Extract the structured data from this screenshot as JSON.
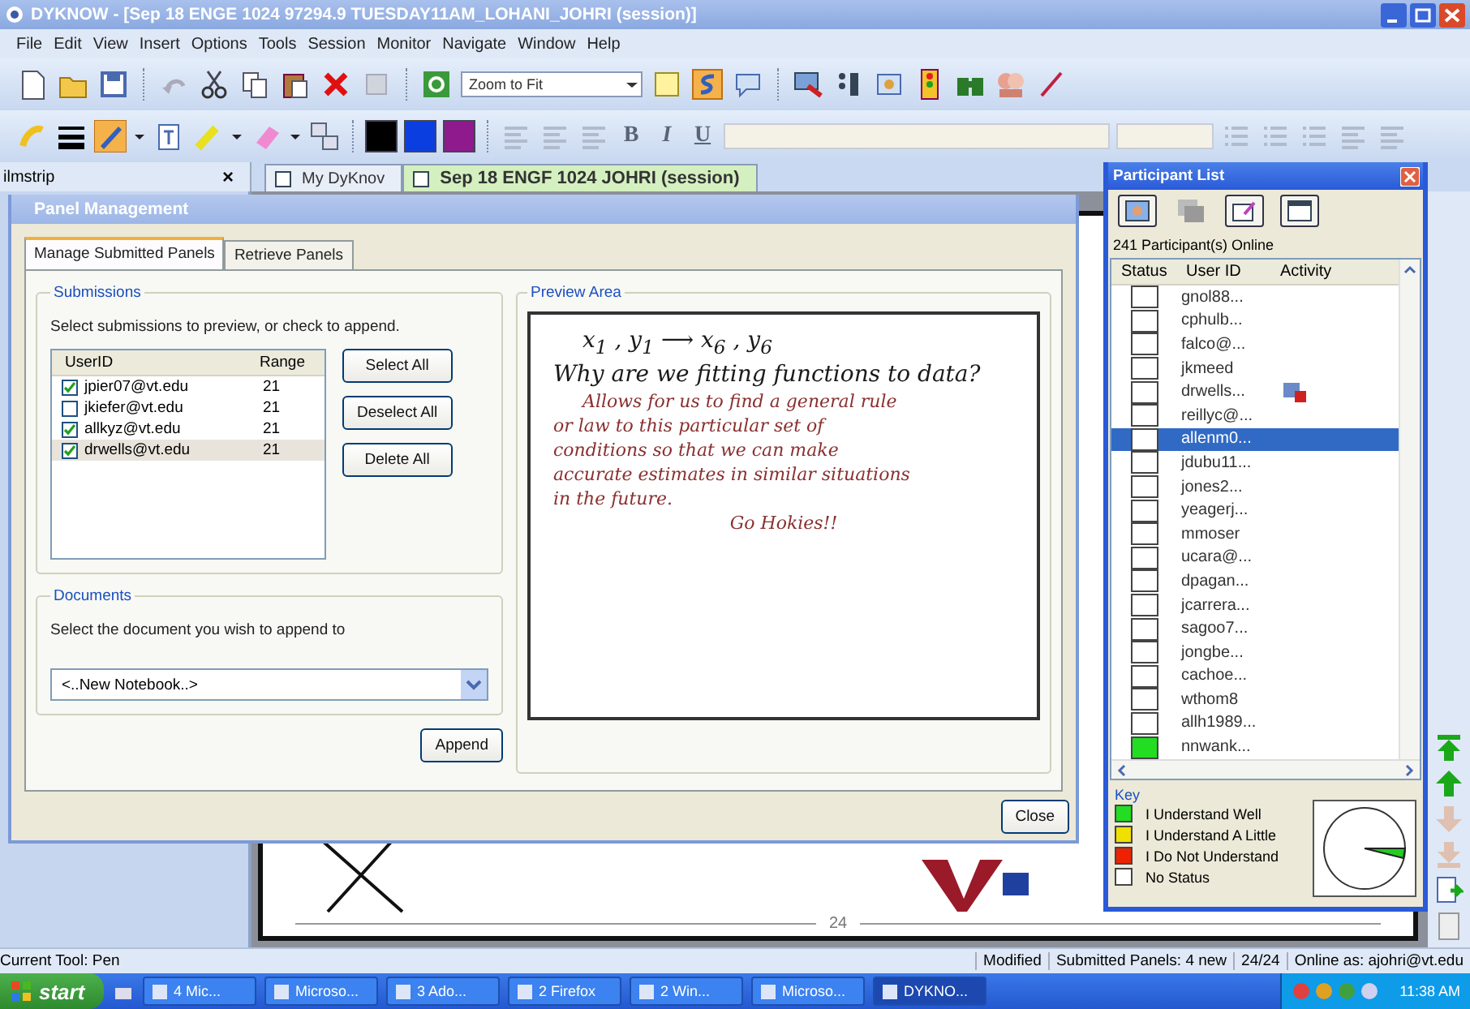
{
  "window": {
    "title": "DYKNOW - [Sep 18 ENGE 1024 97294.9 TUESDAY11AM_LOHANI_JOHRI  (session)]"
  },
  "menu": [
    "File",
    "Edit",
    "View",
    "Insert",
    "Options",
    "Tools",
    "Session",
    "Monitor",
    "Navigate",
    "Window",
    "Help"
  ],
  "toolbar": {
    "zoom": "Zoom to Fit",
    "format_buttons": [
      "B",
      "I",
      "U"
    ],
    "palette": [
      {
        "color": "#000000"
      },
      {
        "color": "#0a3ee0"
      },
      {
        "color": "#8e1a8e"
      }
    ]
  },
  "filmstrip": {
    "title": "ilmstrip",
    "close": "×"
  },
  "doc_tabs": [
    {
      "label": "My DyKnov",
      "selected": false
    },
    {
      "label": "Sep 18 ENGF 1024  JOHRI  (session)",
      "selected": true
    }
  ],
  "dialog": {
    "title": "Panel Management",
    "tabs": [
      {
        "label": "Manage Submitted Panels",
        "selected": true
      },
      {
        "label": "Retrieve Panels",
        "selected": false
      }
    ],
    "submissions": {
      "title": "Submissions",
      "instruction": "Select submissions to preview, or check to append.",
      "columns": [
        "UserID",
        "Range"
      ],
      "rows": [
        {
          "user": "jpier07@vt.edu",
          "range": "21",
          "checked": true,
          "selected": false
        },
        {
          "user": "jkiefer@vt.edu",
          "range": "21",
          "checked": false,
          "selected": false
        },
        {
          "user": "allkyz@vt.edu",
          "range": "21",
          "checked": true,
          "selected": false
        },
        {
          "user": "drwells@vt.edu",
          "range": "21",
          "checked": true,
          "selected": true
        }
      ]
    },
    "buttons": [
      "Select All",
      "Deselect All",
      "Delete All"
    ],
    "documents": {
      "title": "Documents",
      "instruction": "Select the document you wish to append to",
      "value": "<..New Notebook..>"
    },
    "append": "Append",
    "preview": {
      "title": "Preview Area",
      "ink": [
        {
          "text": "x$_{1}$ , y$_{1}$  ⟶  x$_{6}$ , y$_{6}$",
          "color": "#1a1a1a"
        },
        {
          "text": "Why are we fitting functions to data?",
          "color": "#1a1a1a"
        },
        {
          "text": "Allows for us to find a general rule",
          "color": "#8a3030"
        },
        {
          "text": "or law to this particular set of",
          "color": "#8a3030"
        },
        {
          "text": "conditions so that we can make",
          "color": "#8a3030"
        },
        {
          "text": "accurate estimates in similar situations",
          "color": "#8a3030"
        },
        {
          "text": "in the future.",
          "color": "#8a3030"
        },
        {
          "text": "Go Hokies!!",
          "color": "#8a3030"
        }
      ]
    },
    "close": "Close"
  },
  "participants": {
    "title": "Participant List",
    "online": "241 Participant(s) Online",
    "columns": [
      "Status",
      "User ID",
      "Activity"
    ],
    "rows": [
      {
        "user": "gnol88...",
        "color": "#ffffff",
        "activity": false,
        "selected": false
      },
      {
        "user": "cphulb...",
        "color": "#ffffff",
        "activity": false,
        "selected": false
      },
      {
        "user": "falco@...",
        "color": "#ffffff",
        "activity": false,
        "selected": false
      },
      {
        "user": "jkmeed",
        "color": "#ffffff",
        "activity": false,
        "selected": false
      },
      {
        "user": "drwells...",
        "color": "#ffffff",
        "activity": true,
        "selected": false
      },
      {
        "user": "reillyc@...",
        "color": "#ffffff",
        "activity": false,
        "selected": false
      },
      {
        "user": "allenm0...",
        "color": "#ffffff",
        "activity": false,
        "selected": true
      },
      {
        "user": "jdubu11...",
        "color": "#ffffff",
        "activity": false,
        "selected": false
      },
      {
        "user": "jones2...",
        "color": "#ffffff",
        "activity": false,
        "selected": false
      },
      {
        "user": "yeagerj...",
        "color": "#ffffff",
        "activity": false,
        "selected": false
      },
      {
        "user": "mmoser",
        "color": "#ffffff",
        "activity": false,
        "selected": false
      },
      {
        "user": "ucara@...",
        "color": "#ffffff",
        "activity": false,
        "selected": false
      },
      {
        "user": "dpagan...",
        "color": "#ffffff",
        "activity": false,
        "selected": false
      },
      {
        "user": "jcarrera...",
        "color": "#ffffff",
        "activity": false,
        "selected": false
      },
      {
        "user": "sagoo7...",
        "color": "#ffffff",
        "activity": false,
        "selected": false
      },
      {
        "user": "jongbe...",
        "color": "#ffffff",
        "activity": false,
        "selected": false
      },
      {
        "user": "cachoe...",
        "color": "#ffffff",
        "activity": false,
        "selected": false
      },
      {
        "user": "wthom8",
        "color": "#ffffff",
        "activity": false,
        "selected": false
      },
      {
        "user": "allh1989...",
        "color": "#ffffff",
        "activity": false,
        "selected": false
      },
      {
        "user": "nnwank...",
        "color": "#22dd22",
        "activity": false,
        "selected": false
      }
    ],
    "key_title": "Key",
    "key": [
      {
        "label": "I Understand Well",
        "color": "#22dd22"
      },
      {
        "label": "I Understand A Little",
        "color": "#f0e000"
      },
      {
        "label": "I Do Not Understand",
        "color": "#ee2200"
      },
      {
        "label": "No Status",
        "color": "#ffffff"
      }
    ]
  },
  "slide": {
    "page": "24"
  },
  "status_bar": {
    "tool": "Current Tool: Pen",
    "fields": [
      "Modified",
      "Submitted Panels: 4 new",
      "24/24",
      "Online as: ajohri@vt.edu"
    ]
  },
  "taskbar": {
    "start": "start",
    "items": [
      {
        "label": "4 Mic...",
        "selected": false
      },
      {
        "label": "Microso...",
        "selected": false
      },
      {
        "label": "3 Ado...",
        "selected": false
      },
      {
        "label": "2 Firefox",
        "selected": false
      },
      {
        "label": "2 Win...",
        "selected": false
      },
      {
        "label": "Microso...",
        "selected": false
      },
      {
        "label": "DYKNO...",
        "selected": true
      }
    ],
    "clock": "11:38 AM"
  }
}
